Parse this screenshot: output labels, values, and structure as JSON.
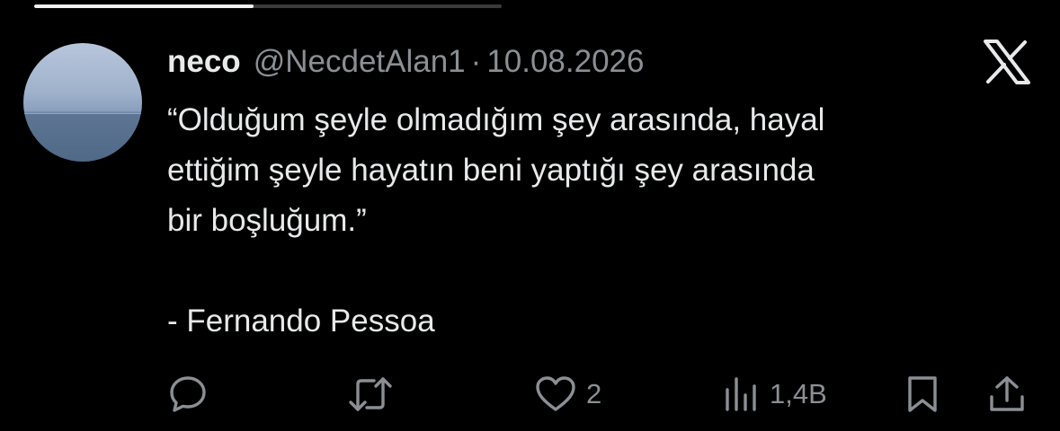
{
  "story": {
    "progress": 0.47
  },
  "tweet": {
    "author_name": "neco",
    "handle": "@NecdetAlan1",
    "separator": "·",
    "date": "10.08.2026",
    "quote": "“Olduğum şeyle olmadığım şey arasında, hayal\nettiğim şeyle hayatın beni yaptığı şey arasında\nbir boşluğum.”",
    "attribution": "- Fernando Pessoa"
  },
  "actions": {
    "reply_icon": "reply-icon",
    "retweet_icon": "retweet-icon",
    "like_icon": "heart-icon",
    "like_count": "2",
    "views_icon": "views-icon",
    "views_count": "1,4B",
    "bookmark_icon": "bookmark-icon",
    "share_icon": "share-icon"
  },
  "brand": {
    "logo": "x-logo",
    "colors": {
      "background": "#000000",
      "text": "#e7e9ea",
      "muted": "#8b8f94"
    }
  }
}
